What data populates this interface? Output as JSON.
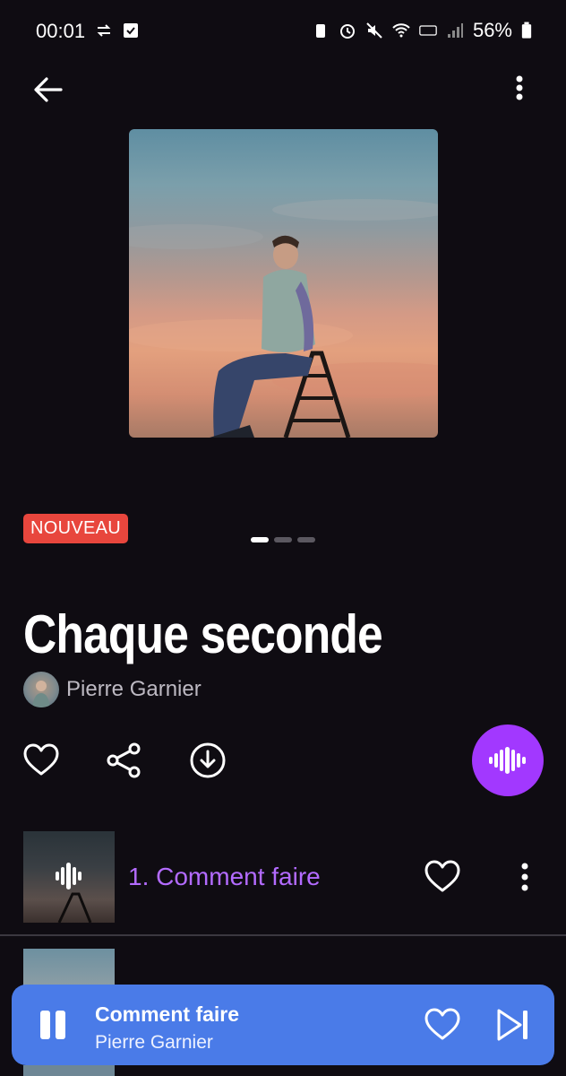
{
  "status_bar": {
    "time": "00:01",
    "battery": "56%",
    "icons": [
      "sync-icon",
      "check-square-icon",
      "battery-saver-icon",
      "alarm-icon",
      "mute-icon",
      "wifi-icon",
      "volte-icon",
      "signal-icon",
      "battery-icon"
    ]
  },
  "header": {
    "back_icon": "arrow-left-icon",
    "more_icon": "more-vertical-icon"
  },
  "album": {
    "badge": "NOUVEAU",
    "title": "Chaque seconde",
    "artist": "Pierre Garnier",
    "pager": {
      "count": 3,
      "active": 0
    }
  },
  "actions": {
    "like_icon": "heart-icon",
    "share_icon": "share-icon",
    "download_icon": "download-icon",
    "play_icon": "deezer-waveform-icon"
  },
  "tracks": [
    {
      "title": "1. Comment faire",
      "playing": true
    }
  ],
  "mini_player": {
    "title": "Comment faire",
    "artist": "Pierre Garnier",
    "state": "playing"
  },
  "colors": {
    "background": "#0f0c12",
    "accent_purple": "#a238ff",
    "playing_track": "#b36bff",
    "badge_red": "#e8463d",
    "mini_player_blue": "#4a7be8"
  }
}
